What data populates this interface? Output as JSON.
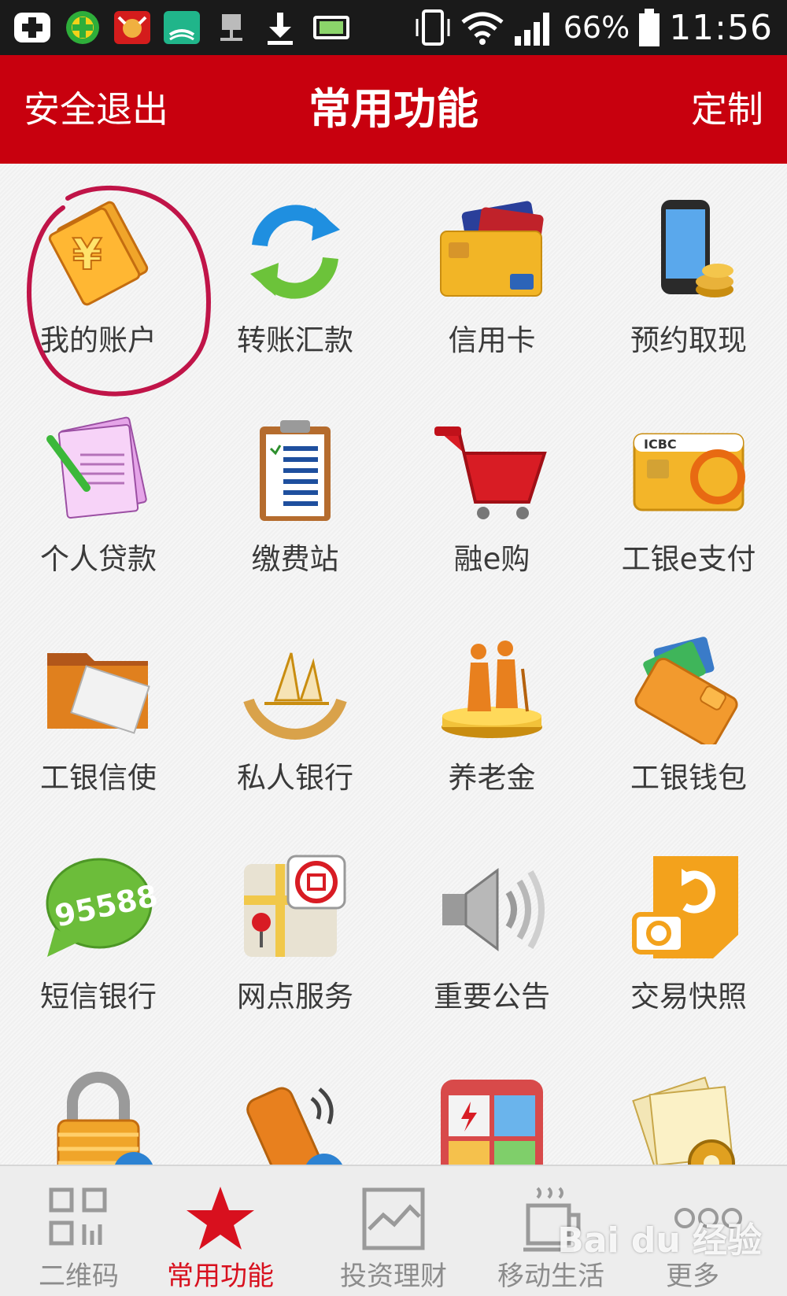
{
  "status_bar": {
    "battery": "66%",
    "time": "11:56",
    "icons": [
      "add-app-icon",
      "clover-icon",
      "bull-app-icon",
      "word-app-icon",
      "network-icon",
      "download-icon",
      "battery-app-icon",
      "vibrate-icon",
      "wifi-icon",
      "signal-icon",
      "battery-icon"
    ]
  },
  "header": {
    "left_button": "安全退出",
    "title": "常用功能",
    "right_button": "定制"
  },
  "grid": {
    "items": [
      {
        "label": "我的账户",
        "icon": "account-book-icon"
      },
      {
        "label": "转账汇款",
        "icon": "transfer-arrows-icon"
      },
      {
        "label": "信用卡",
        "icon": "credit-card-icon"
      },
      {
        "label": "预约取现",
        "icon": "phone-coins-icon"
      },
      {
        "label": "个人贷款",
        "icon": "loan-form-icon"
      },
      {
        "label": "缴费站",
        "icon": "clipboard-icon"
      },
      {
        "label": "融e购",
        "icon": "shopping-cart-icon"
      },
      {
        "label": "工银e支付",
        "icon": "icbc-card-icon"
      },
      {
        "label": "工银信使",
        "icon": "mail-folder-icon"
      },
      {
        "label": "私人银行",
        "icon": "sailboat-icon"
      },
      {
        "label": "养老金",
        "icon": "elderly-podium-icon"
      },
      {
        "label": "工银钱包",
        "icon": "wallet-icon"
      },
      {
        "label": "短信银行",
        "icon": "sms-bubble-icon"
      },
      {
        "label": "网点服务",
        "icon": "branch-map-icon"
      },
      {
        "label": "重要公告",
        "icon": "speaker-icon"
      },
      {
        "label": "交易快照",
        "icon": "snapshot-icon"
      },
      {
        "label": "",
        "icon": "padlock-icon"
      },
      {
        "label": "",
        "icon": "mobile-phone-icon"
      },
      {
        "label": "",
        "icon": "utilities-icon"
      },
      {
        "label": "",
        "icon": "settings-docs-icon"
      }
    ]
  },
  "bottom_nav": {
    "items": [
      {
        "label": "二维码",
        "icon": "qr-code-icon",
        "active": false
      },
      {
        "label": "常用功能",
        "icon": "star-icon",
        "active": true
      },
      {
        "label": "投资理财",
        "icon": "chart-icon",
        "active": false
      },
      {
        "label": "移动生活",
        "icon": "coffee-cup-icon",
        "active": false
      },
      {
        "label": "更多",
        "icon": "more-dots-icon",
        "active": false
      }
    ]
  },
  "watermark": "Bai du 经验",
  "colors": {
    "header_red": "#c8000e",
    "active_red": "#d8101e",
    "annotation_circle": "#c01448"
  }
}
